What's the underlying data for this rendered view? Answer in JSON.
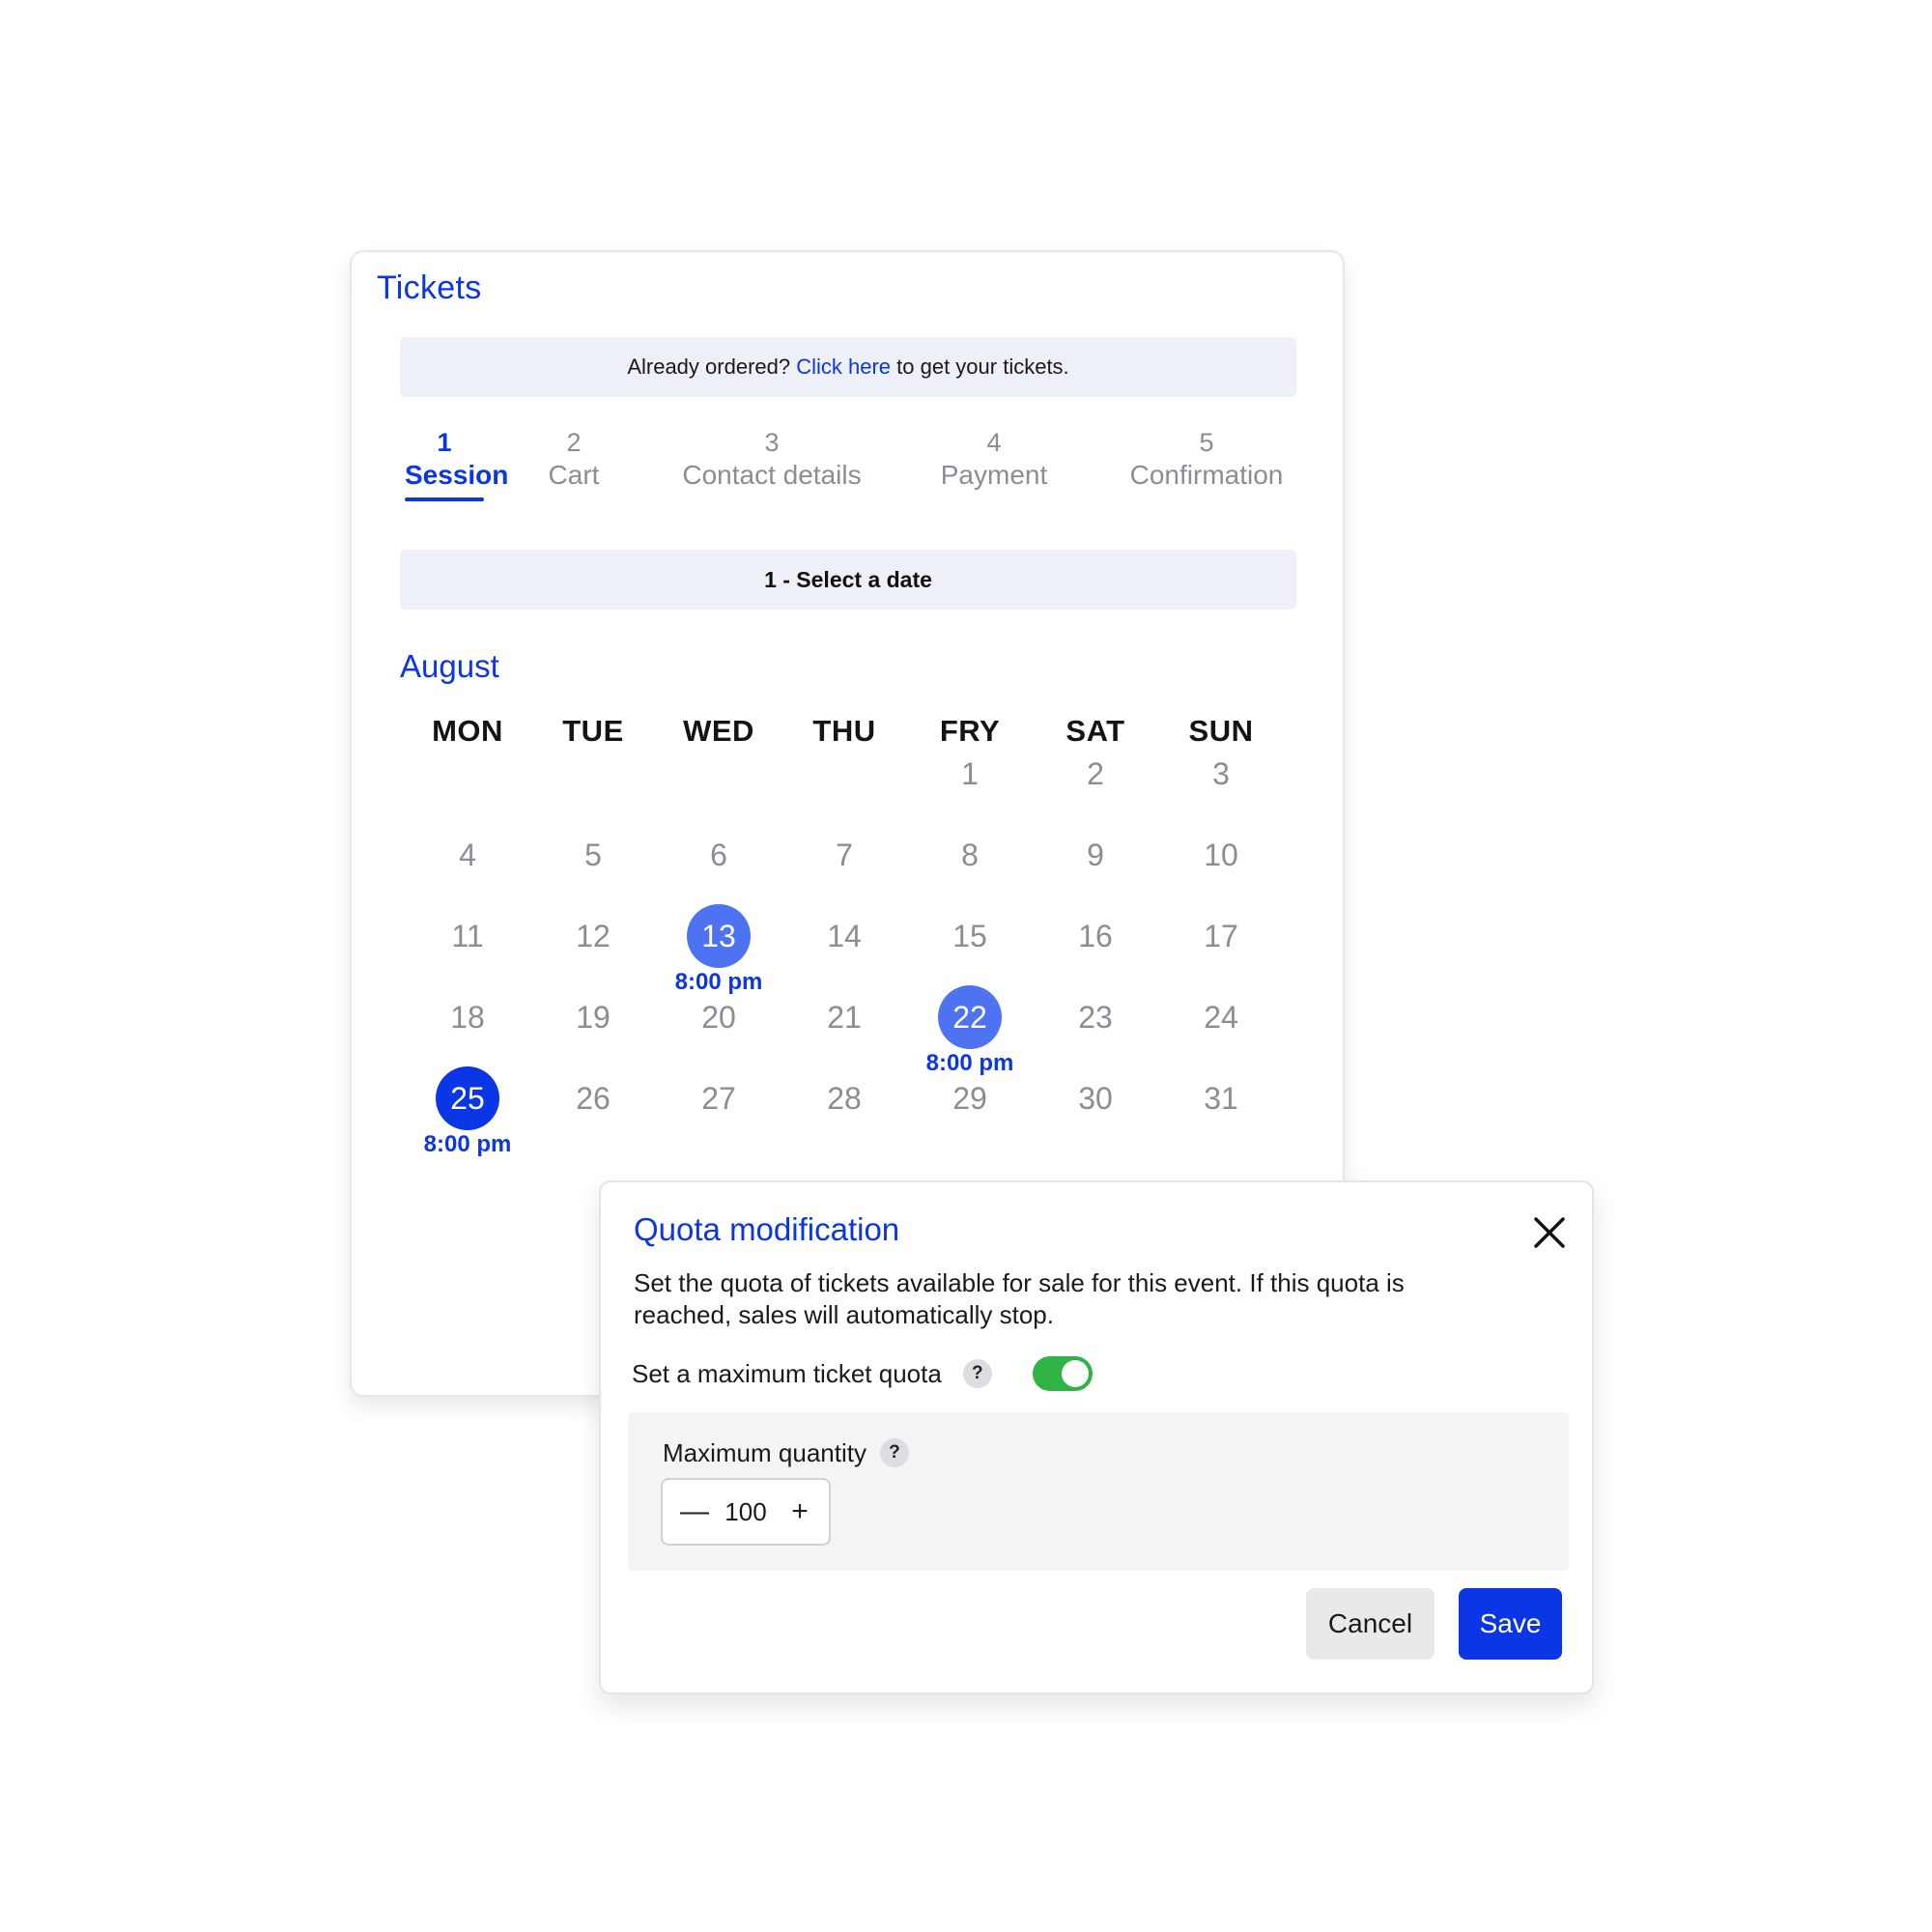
{
  "tickets": {
    "title": "Tickets",
    "banner": {
      "prefix": "Already ordered? ",
      "link": "Click here",
      "suffix": " to get your tickets."
    },
    "steps": [
      {
        "num": "1",
        "label": "Session",
        "active": true
      },
      {
        "num": "2",
        "label": "Cart",
        "active": false
      },
      {
        "num": "3",
        "label": "Contact details",
        "active": false
      },
      {
        "num": "4",
        "label": "Payment",
        "active": false
      },
      {
        "num": "5",
        "label": "Confirmation",
        "active": false
      }
    ],
    "select_bar": "1 - Select a date",
    "calendar": {
      "month": "August",
      "weekdays": [
        "MON",
        "TUE",
        "WED",
        "THU",
        "FRY",
        "SAT",
        "SUN"
      ],
      "days": [
        "",
        "",
        "",
        "",
        "1",
        "2",
        "3",
        "4",
        "5",
        "6",
        "7",
        "8",
        "9",
        "10",
        "11",
        "12",
        "13",
        "14",
        "15",
        "16",
        "17",
        "18",
        "19",
        "20",
        "21",
        "22",
        "23",
        "24",
        "25",
        "26",
        "27",
        "28",
        "29",
        "30",
        "31"
      ],
      "sessions": [
        {
          "day": "13",
          "time": "8:00 pm",
          "state": "available"
        },
        {
          "day": "22",
          "time": "8:00 pm",
          "state": "available"
        },
        {
          "day": "25",
          "time": "8:00 pm",
          "state": "selected"
        }
      ]
    }
  },
  "quota_modal": {
    "title": "Quota modification",
    "description": "Set the quota of tickets available for sale for this event. If this quota is reached, sales will automatically stop.",
    "max_quota_label": "Set a maximum ticket quota",
    "help_glyph": "?",
    "toggle_on": true,
    "quantity": {
      "label": "Maximum quantity",
      "value": "100",
      "minus": "—",
      "plus": "+"
    },
    "cancel_label": "Cancel",
    "save_label": "Save"
  },
  "colors": {
    "accent": "#0a36e6",
    "session_available": "#4d72f2",
    "toggle_on": "#2fb344",
    "muted_text": "#8a8d93",
    "banner_bg": "#eef0f8"
  },
  "icons": {
    "close": "close-icon",
    "help": "question-mark-icon",
    "minus": "minus-icon",
    "plus": "plus-icon"
  }
}
